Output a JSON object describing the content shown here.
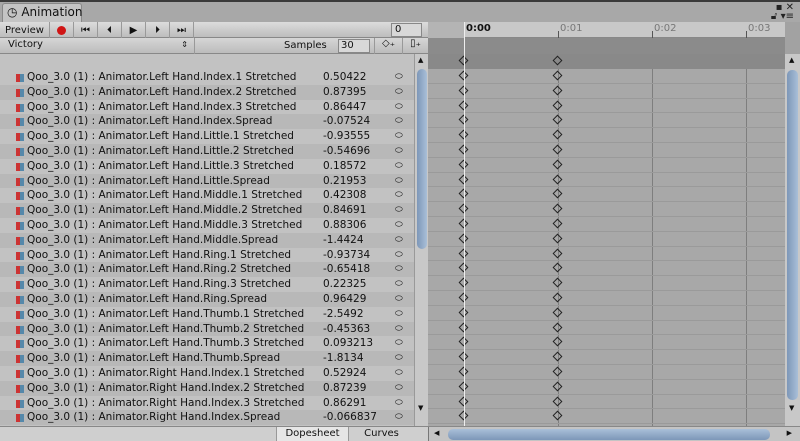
{
  "window": {
    "tab_title": "Animation",
    "clock_icon": "clock-icon",
    "maximize_icon": "maximize-icon",
    "close_icon": "close-icon",
    "lock_icon": "lock-icon",
    "menu_icon": "menu-icon"
  },
  "toolbar": {
    "preview_label": "Preview",
    "record_color": "#d01515",
    "frame_value": "0"
  },
  "clip": {
    "name": "Victory",
    "samples_label": "Samples",
    "samples_value": "30"
  },
  "ruler": {
    "ticks": [
      "0:00",
      "0:01",
      "0:02",
      "0:03"
    ]
  },
  "keyframe_times": [
    "0:00",
    "0:01"
  ],
  "properties": [
    {
      "name": "Qoo_3.0 (1) : Animator.Left Hand.Index.1 Stretched",
      "value": "0.50422"
    },
    {
      "name": "Qoo_3.0 (1) : Animator.Left Hand.Index.2 Stretched",
      "value": "0.87395"
    },
    {
      "name": "Qoo_3.0 (1) : Animator.Left Hand.Index.3 Stretched",
      "value": "0.86447"
    },
    {
      "name": "Qoo_3.0 (1) : Animator.Left Hand.Index.Spread",
      "value": "-0.07524"
    },
    {
      "name": "Qoo_3.0 (1) : Animator.Left Hand.Little.1 Stretched",
      "value": "-0.93555"
    },
    {
      "name": "Qoo_3.0 (1) : Animator.Left Hand.Little.2 Stretched",
      "value": "-0.54696"
    },
    {
      "name": "Qoo_3.0 (1) : Animator.Left Hand.Little.3 Stretched",
      "value": "0.18572"
    },
    {
      "name": "Qoo_3.0 (1) : Animator.Left Hand.Little.Spread",
      "value": "0.21953"
    },
    {
      "name": "Qoo_3.0 (1) : Animator.Left Hand.Middle.1 Stretched",
      "value": "0.42308"
    },
    {
      "name": "Qoo_3.0 (1) : Animator.Left Hand.Middle.2 Stretched",
      "value": "0.84691"
    },
    {
      "name": "Qoo_3.0 (1) : Animator.Left Hand.Middle.3 Stretched",
      "value": "0.88306"
    },
    {
      "name": "Qoo_3.0 (1) : Animator.Left Hand.Middle.Spread",
      "value": "-1.4424"
    },
    {
      "name": "Qoo_3.0 (1) : Animator.Left Hand.Ring.1 Stretched",
      "value": "-0.93734"
    },
    {
      "name": "Qoo_3.0 (1) : Animator.Left Hand.Ring.2 Stretched",
      "value": "-0.65418"
    },
    {
      "name": "Qoo_3.0 (1) : Animator.Left Hand.Ring.3 Stretched",
      "value": "0.22325"
    },
    {
      "name": "Qoo_3.0 (1) : Animator.Left Hand.Ring.Spread",
      "value": "0.96429"
    },
    {
      "name": "Qoo_3.0 (1) : Animator.Left Hand.Thumb.1 Stretched",
      "value": "-2.5492"
    },
    {
      "name": "Qoo_3.0 (1) : Animator.Left Hand.Thumb.2 Stretched",
      "value": "-0.45363"
    },
    {
      "name": "Qoo_3.0 (1) : Animator.Left Hand.Thumb.3 Stretched",
      "value": "0.093213"
    },
    {
      "name": "Qoo_3.0 (1) : Animator.Left Hand.Thumb.Spread",
      "value": "-1.8134"
    },
    {
      "name": "Qoo_3.0 (1) : Animator.Right Hand.Index.1 Stretched",
      "value": "0.52924"
    },
    {
      "name": "Qoo_3.0 (1) : Animator.Right Hand.Index.2 Stretched",
      "value": "0.87239"
    },
    {
      "name": "Qoo_3.0 (1) : Animator.Right Hand.Index.3 Stretched",
      "value": "0.86291"
    },
    {
      "name": "Qoo_3.0 (1) : Animator.Right Hand.Index.Spread",
      "value": "-0.066837"
    }
  ],
  "bottom": {
    "dopesheet_label": "Dopesheet",
    "curves_label": "Curves"
  }
}
